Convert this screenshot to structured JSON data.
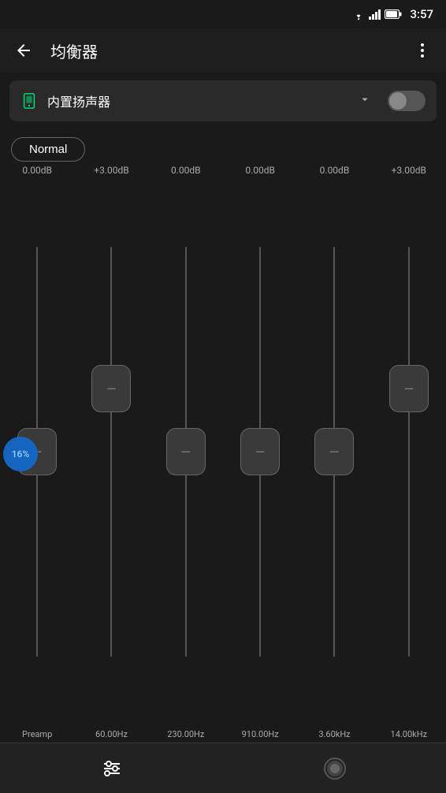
{
  "status": {
    "time": "3:57",
    "icons": [
      "wifi",
      "signal",
      "battery"
    ]
  },
  "header": {
    "back_label": "←",
    "title": "均衡器",
    "more_label": "⋮"
  },
  "device": {
    "name": "内置扬声器",
    "dropdown_label": "▼",
    "toggle_state": false
  },
  "preset": {
    "label": "Normal"
  },
  "equalizer": {
    "db_values": [
      "0.00dB",
      "+3.00dB",
      "0.00dB",
      "0.00dB",
      "0.00dB",
      "+3.00dB"
    ],
    "freq_labels": [
      "Preamp",
      "60.00Hz",
      "230.00Hz",
      "910.00Hz",
      "3.60kHz",
      "14.00kHz"
    ],
    "thumb_offsets": [
      0,
      -50,
      0,
      0,
      0,
      -50
    ],
    "percent_badge": "16%"
  },
  "bottom_nav": {
    "eq_icon": "⊞",
    "profile_icon": "●"
  }
}
